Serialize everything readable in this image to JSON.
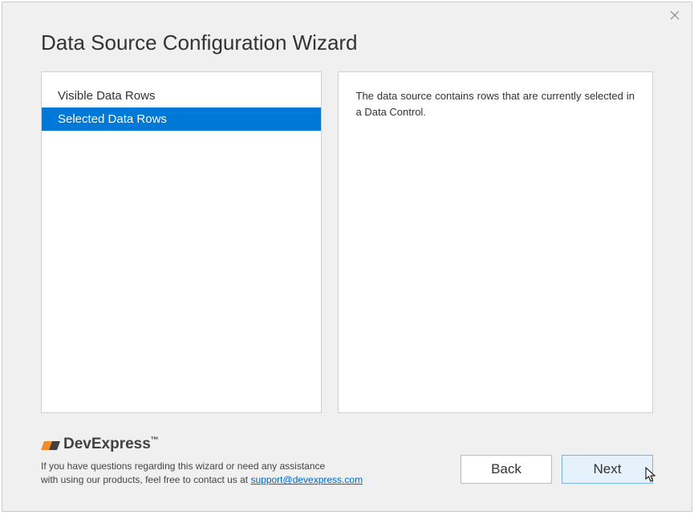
{
  "window": {
    "title": "Data Source Configuration Wizard"
  },
  "options": {
    "items": [
      {
        "label": "Visible Data Rows",
        "selected": false
      },
      {
        "label": "Selected Data Rows",
        "selected": true
      }
    ]
  },
  "description": {
    "text": "The data source contains rows that are currently selected in a Data Control."
  },
  "footer": {
    "logo_text": "DevExpress",
    "help_line1": "If you have questions regarding this wizard or need any assistance",
    "help_line2_prefix": "with using our products, feel free to contact us at ",
    "help_link": "support@devexpress.com"
  },
  "buttons": {
    "back": "Back",
    "next": "Next"
  }
}
